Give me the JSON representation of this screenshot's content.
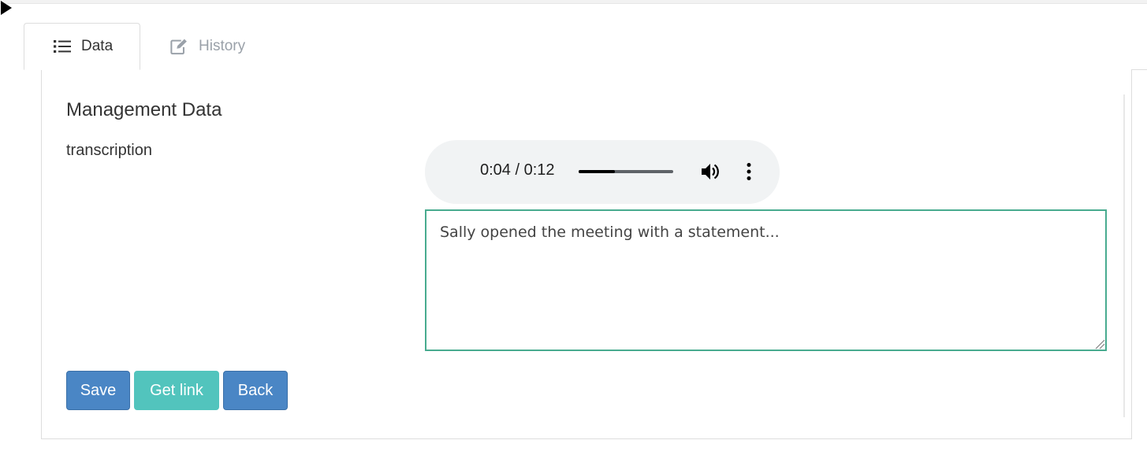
{
  "tabs": [
    {
      "label": "Data",
      "icon": "list-icon",
      "active": true
    },
    {
      "label": "History",
      "icon": "edit-icon",
      "active": false
    }
  ],
  "section": {
    "title": "Management Data"
  },
  "field": {
    "label": "transcription"
  },
  "audio": {
    "time_display": "0:04 / 0:12",
    "progress_fraction": 0.38,
    "play_icon": "play-icon",
    "volume_icon": "volume-icon",
    "menu_icon": "more-vert-icon"
  },
  "textarea": {
    "value": "Sally opened the meeting with a statement..."
  },
  "buttons": {
    "save": "Save",
    "get_link": "Get link",
    "back": "Back"
  },
  "colors": {
    "primary": "#4a86c5",
    "info": "#52c4bd",
    "focus_border": "#48ab8f",
    "muted_tab": "#9aa1a9"
  }
}
